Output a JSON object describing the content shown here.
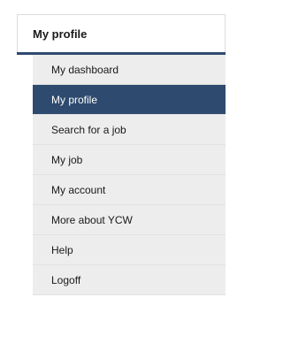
{
  "panel": {
    "title": "My profile",
    "accent_color": "#2e4a6e"
  },
  "nav": {
    "items": [
      {
        "label": "My dashboard",
        "active": false
      },
      {
        "label": "My profile",
        "active": true
      },
      {
        "label": "Search for a job",
        "active": false
      },
      {
        "label": "My job",
        "active": false
      },
      {
        "label": "My account",
        "active": false
      },
      {
        "label": "More about YCW",
        "active": false
      },
      {
        "label": "Help",
        "active": false
      },
      {
        "label": "Logoff",
        "active": false
      }
    ]
  }
}
